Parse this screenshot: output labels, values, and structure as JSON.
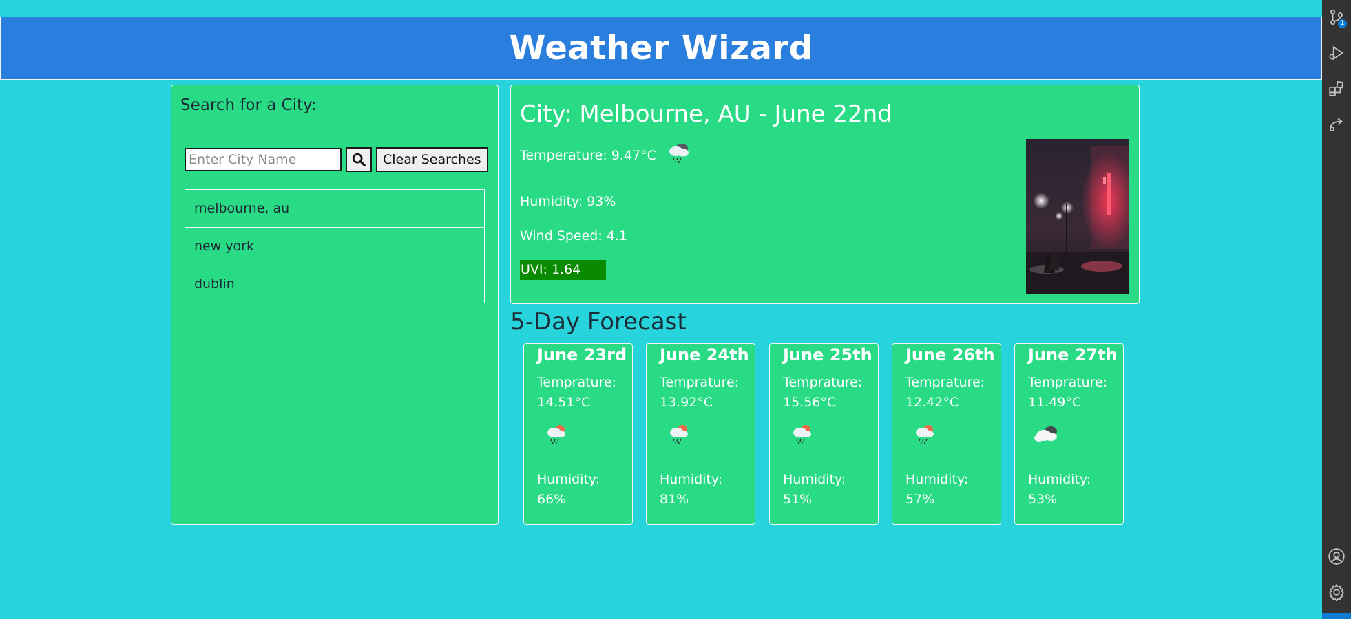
{
  "app": {
    "title": "Weather Wizard"
  },
  "search": {
    "heading": "Search for a City:",
    "placeholder": "Enter City Name",
    "search_icon": "magnifier-icon",
    "clear_label": "Clear Searches",
    "history": [
      "melbourne, au",
      "new york",
      "dublin"
    ]
  },
  "current": {
    "title": "City: Melbourne, AU - June 22nd",
    "temperature": "Temperature: 9.47°C",
    "weather_icon": "rain-cloud-icon",
    "humidity": "Humidity: 93%",
    "wind": "Wind Speed: 4.1",
    "uvi": "UVI: 1.64",
    "uvi_color": "#0a8a00"
  },
  "forecast": {
    "title": "5-Day Forecast",
    "temp_label": "Temprature:",
    "humidity_label": "Humidity:",
    "days": [
      {
        "date": "June 23rd",
        "temp": "14.51°C",
        "humidity": "66%",
        "icon": "sun-rain-cloud-icon"
      },
      {
        "date": "June 24th",
        "temp": "13.92°C",
        "humidity": "81%",
        "icon": "sun-rain-cloud-icon"
      },
      {
        "date": "June 25th",
        "temp": "15.56°C",
        "humidity": "51%",
        "icon": "sun-rain-cloud-icon"
      },
      {
        "date": "June 26th",
        "temp": "12.42°C",
        "humidity": "57%",
        "icon": "sun-rain-cloud-icon"
      },
      {
        "date": "June 27th",
        "temp": "11.49°C",
        "humidity": "53%",
        "icon": "broken-clouds-icon"
      }
    ]
  },
  "activity_bar": {
    "items": [
      "source-control-icon",
      "run-debug-icon",
      "extensions-icon",
      "remote-icon",
      "account-icon",
      "settings-icon"
    ],
    "source_control_badge": "1"
  },
  "colors": {
    "background": "#27d4dc",
    "header": "#2a7fde",
    "panel": "#2adb86"
  }
}
